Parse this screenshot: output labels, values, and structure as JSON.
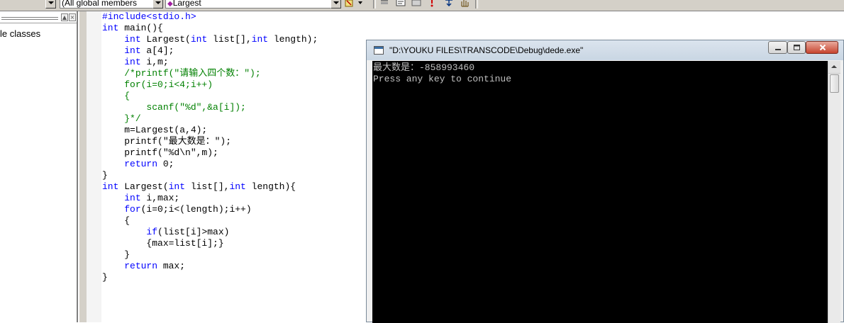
{
  "toolbar": {
    "scope_combo": "(All global members",
    "function_combo": "Largest"
  },
  "classview": {
    "item_label": "le classes"
  },
  "editor": {
    "lines": [
      [
        {
          "t": "#include<stdio.h>",
          "c": "pp"
        }
      ],
      [
        {
          "t": "int",
          "c": "kw"
        },
        {
          "t": " main(){"
        }
      ],
      [
        {
          "t": "    "
        },
        {
          "t": "int",
          "c": "kw"
        },
        {
          "t": " Largest("
        },
        {
          "t": "int",
          "c": "kw"
        },
        {
          "t": " list[],"
        },
        {
          "t": "int",
          "c": "kw"
        },
        {
          "t": " length);"
        }
      ],
      [
        {
          "t": "    "
        },
        {
          "t": "int",
          "c": "kw"
        },
        {
          "t": " a[4];"
        }
      ],
      [
        {
          "t": "    "
        },
        {
          "t": "int",
          "c": "kw"
        },
        {
          "t": " i,m;"
        }
      ],
      [
        {
          "t": "    "
        },
        {
          "t": "/*printf(\"请输入四个数：\");",
          "c": "cm"
        }
      ],
      [
        {
          "t": "    "
        },
        {
          "t": "for(i=0;i<4;i++)",
          "c": "cm"
        }
      ],
      [
        {
          "t": "    "
        },
        {
          "t": "{",
          "c": "cm"
        }
      ],
      [
        {
          "t": "        "
        },
        {
          "t": "scanf(\"%d\",&a[i]);",
          "c": "cm"
        }
      ],
      [
        {
          "t": "    "
        },
        {
          "t": "}*/",
          "c": "cm"
        }
      ],
      [
        {
          "t": "    m=Largest(a,4);"
        }
      ],
      [
        {
          "t": "    printf(\"最大数是：\");"
        }
      ],
      [
        {
          "t": "    printf(\"%d\\n\",m);"
        }
      ],
      [
        {
          "t": "    "
        },
        {
          "t": "return",
          "c": "kw"
        },
        {
          "t": " 0;"
        }
      ],
      [
        {
          "t": "}"
        }
      ],
      [
        {
          "t": "int",
          "c": "kw"
        },
        {
          "t": " Largest("
        },
        {
          "t": "int",
          "c": "kw"
        },
        {
          "t": " list[],"
        },
        {
          "t": "int",
          "c": "kw"
        },
        {
          "t": " length){"
        }
      ],
      [
        {
          "t": "    "
        },
        {
          "t": "int",
          "c": "kw"
        },
        {
          "t": " i,max;"
        }
      ],
      [
        {
          "t": "    "
        },
        {
          "t": "for",
          "c": "kw"
        },
        {
          "t": "(i=0;i<(length);i++)"
        }
      ],
      [
        {
          "t": "    {"
        }
      ],
      [
        {
          "t": "        "
        },
        {
          "t": "if",
          "c": "kw"
        },
        {
          "t": "(list[i]>max)"
        }
      ],
      [
        {
          "t": "        {max=list[i];}"
        }
      ],
      [
        {
          "t": "    }"
        }
      ],
      [
        {
          "t": "    "
        },
        {
          "t": "return",
          "c": "kw"
        },
        {
          "t": " max;"
        }
      ],
      [
        {
          "t": "}"
        }
      ]
    ]
  },
  "console": {
    "title": "\"D:\\YOUKU FILES\\TRANSCODE\\Debug\\dede.exe\"",
    "output_line1": "最大数是：-858993460",
    "output_line2": "Press any key to continue"
  },
  "colors": {
    "keyword": "#0000ff",
    "comment": "#008000",
    "console_bg": "#000000",
    "console_text": "#c0c0c0"
  }
}
